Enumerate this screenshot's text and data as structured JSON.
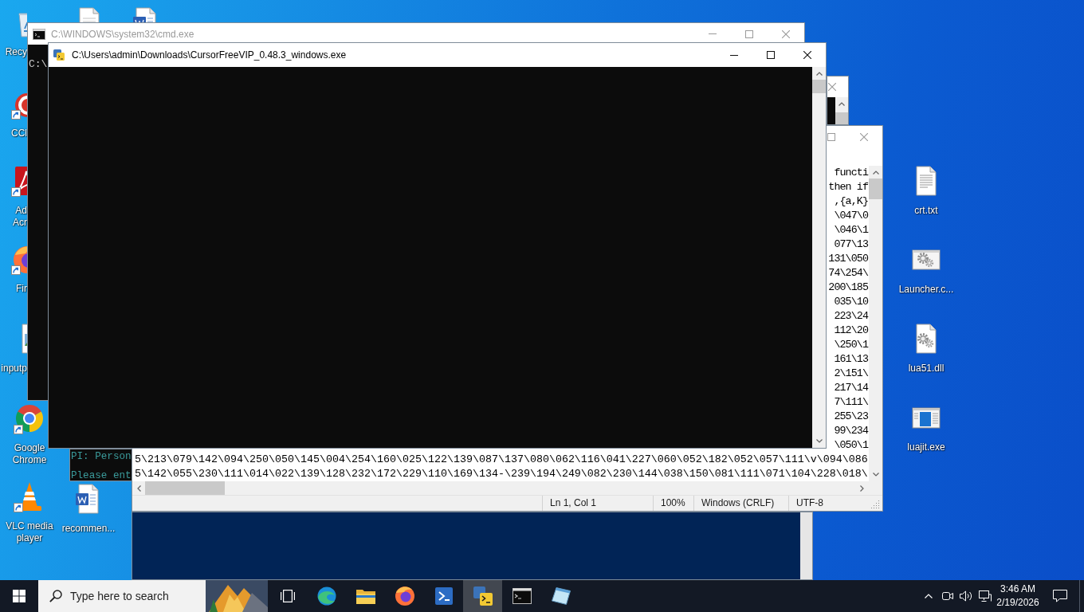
{
  "desktop": {
    "icons": [
      {
        "kind": "recycle-bin",
        "label": "Recy",
        "shortcut": false
      },
      {
        "kind": "ccleaner",
        "label": "CCl",
        "shortcut": true
      },
      {
        "kind": "acrobat",
        "label": "Ad Acr",
        "shortcut": true
      },
      {
        "kind": "firefox",
        "label": "Fir",
        "shortcut": true
      },
      {
        "kind": "image-file",
        "label": "inputp",
        "shortcut": false
      },
      {
        "kind": "chrome",
        "label": "Google Chrome",
        "shortcut": true
      },
      {
        "kind": "vlc",
        "label": "VLC media player",
        "shortcut": true
      },
      {
        "kind": "document",
        "shortcut": false
      },
      {
        "kind": "word-doc",
        "shortcut": false
      },
      {
        "kind": "word-doc",
        "label": "recommen...",
        "shortcut": false
      },
      {
        "kind": "text-file",
        "label": "crt.txt",
        "shortcut": false
      },
      {
        "kind": "settings-window",
        "label": "Launcher.c...",
        "shortcut": false
      },
      {
        "kind": "settings-file",
        "label": "lua51.dll",
        "shortcut": false
      },
      {
        "kind": "app-window",
        "label": "luajit.exe",
        "shortcut": false
      }
    ]
  },
  "cmd_window": {
    "title": "C:\\WINDOWS\\system32\\cmd.exe",
    "active": false,
    "lines": [
      "C:\\"
    ]
  },
  "cursor_window": {
    "title": "C:\\Users\\admin\\Downloads\\CursorFreeVIP_0.48.3_windows.exe",
    "active": true
  },
  "notepad_window": {
    "cut_lines": [
      "functi",
      "then if",
      ",{a,K}",
      "\\047\\0",
      "\\046\\1",
      "077\\13",
      "131\\050",
      "74\\254\\",
      "200\\185",
      "035\\10",
      "223\\24",
      "112\\20",
      "\\250\\1",
      "161\\13",
      "2\\151\\",
      "217\\14",
      "7\\111\\",
      "255\\23",
      "99\\234",
      "\\050\\1"
    ],
    "lines": [
      "5\\213\\079\\142\\094\\250\\050\\145\\004\\254\\160\\025\\122\\139\\087\\137\\080\\062\\116\\041\\227\\060\\052\\182\\052\\057\\111\\v\\094\\086",
      "5\\142\\055\\230\\111\\014\\022\\139\\128\\232\\172\\229\\110\\169\\134-\\239\\194\\249\\082\\230\\144\\038\\150\\081\\111\\071\\104\\228\\018\\"
    ],
    "status_bar": [
      "Ln 1, Col 1",
      "100%",
      "Windows (CRLF)",
      "UTF-8"
    ]
  },
  "console_window": {
    "lines": [
      "PI: Person",
      "Please ent"
    ]
  },
  "taskbar": {
    "search": {
      "placeholder": "Type here to search"
    },
    "apps": [
      {
        "kind": "task-view",
        "selected": false
      },
      {
        "kind": "edge",
        "selected": false
      },
      {
        "kind": "file-explorer",
        "selected": false
      },
      {
        "kind": "firefox",
        "selected": false
      },
      {
        "kind": "powershell",
        "selected": false
      },
      {
        "kind": "python-launcher",
        "selected": true
      },
      {
        "kind": "command-prompt",
        "selected": false
      },
      {
        "kind": "notepad-pad",
        "selected": false
      }
    ],
    "clock": {
      "time": "3:46 AM",
      "date": "2/19/2026"
    }
  }
}
